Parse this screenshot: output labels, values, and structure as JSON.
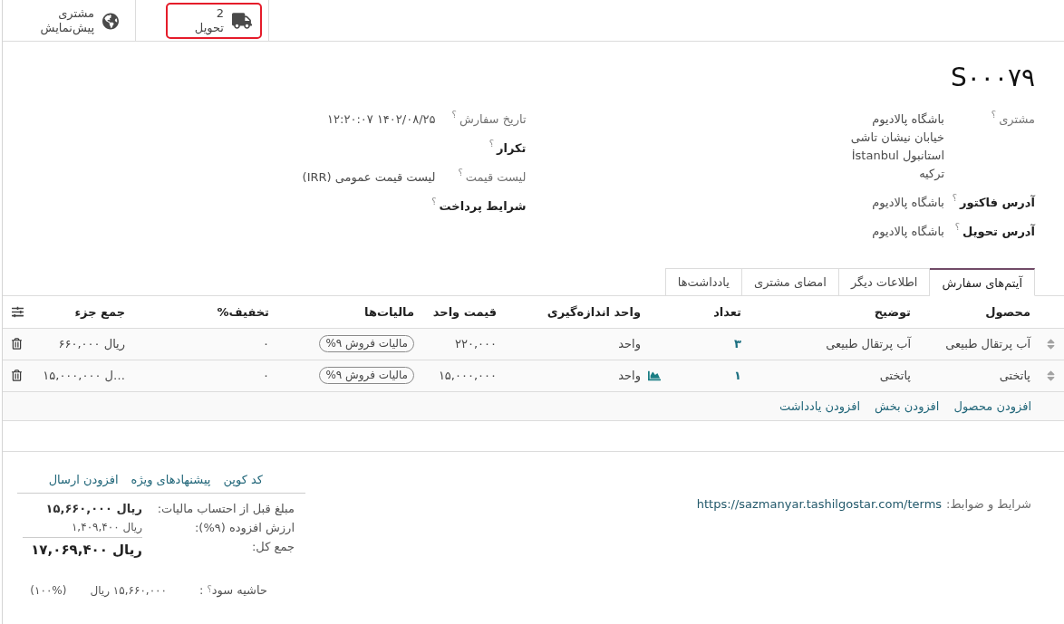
{
  "smart_buttons": [
    {
      "kind": "delivery",
      "value": "2",
      "label": "تحویل",
      "highlighted": true
    },
    {
      "kind": "preview",
      "value": "مشتری",
      "label": "پیش‌نمایش",
      "highlighted": false
    }
  ],
  "record": {
    "name": "S۰۰۰۷۹"
  },
  "field_groups": [
    {
      "fields": [
        {
          "label": "مشتری",
          "help": "؟",
          "emphasized": false,
          "lines": [
            "باشگاه پالادیوم",
            "خیابان نیشان تاشی",
            "استانبول İstanbul",
            "ترکیه"
          ]
        },
        {
          "label": "آدرس فاکتور",
          "help": "؟",
          "emphasized": true,
          "lines": [
            "باشگاه پالادیوم"
          ]
        },
        {
          "label": "آدرس تحویل",
          "help": "؟",
          "emphasized": true,
          "lines": [
            "باشگاه پالادیوم"
          ]
        }
      ]
    },
    {
      "fields": [
        {
          "label": "تاریخ سفارش",
          "help": "؟",
          "emphasized": false,
          "lines": [
            "۱۴۰۲/۰۸/۲۵ ۱۲:۲۰:۰۷"
          ]
        },
        {
          "label": "تکرار",
          "help": "؟",
          "emphasized": true
        },
        {
          "label": "لیست قیمت",
          "help": "؟",
          "emphasized": false,
          "lines": [
            "لیست قیمت عمومی (IRR)"
          ]
        },
        {
          "label": "شرایط پرداخت",
          "help": "؟",
          "emphasized": true
        }
      ]
    }
  ],
  "tabs": [
    {
      "label": "آیتم‌های سفارش",
      "selected": true
    },
    {
      "label": "اطلاعات دیگر",
      "selected": false
    },
    {
      "label": "امضای مشتری",
      "selected": false
    },
    {
      "label": "یادداشت‌ها",
      "selected": false
    }
  ],
  "order_lines": {
    "columns": [
      "محصول",
      "توضیح",
      "تعداد",
      "واحد اندازه‌گیری",
      "قیمت واحد",
      "مالیات‌ها",
      "تخفیف%",
      "جمع جزء"
    ],
    "rows": [
      {
        "product": "آب پرتقال طبیعی",
        "description": "آب پرتقال طبیعی",
        "quantity": "۳",
        "forecast": false,
        "uom": "واحد",
        "unit_price": "۲۲۰,۰۰۰",
        "tax": "مالیات فروش ۹%",
        "discount": "۰",
        "subtotal": "۶۶۰,۰۰۰ ریال"
      },
      {
        "product": "پاتختی",
        "description": "پاتختی",
        "quantity": "۱",
        "forecast": true,
        "uom": "واحد",
        "unit_price": "۱۵,۰۰۰,۰۰۰",
        "tax": "مالیات فروش ۹%",
        "discount": "۰",
        "subtotal": "۱۵,۰۰۰,۰۰۰ ل…"
      }
    ],
    "add_actions": [
      "افزودن محصول",
      "افزودن بخش",
      "افزودن یادداشت"
    ]
  },
  "terms": {
    "label": "شرایط و ضوابط:",
    "url": "https://sazmanyar.tashilgostar.com/terms"
  },
  "promo_buttons": [
    "کد کوپن",
    "پیشنهادهای ویژه",
    "افزودن ارسال"
  ],
  "totals": [
    {
      "kind": "untaxed",
      "label": "مبلغ قبل از احتساب مالیات:",
      "value": "ریال ۱۵,۶۶۰,۰۰۰"
    },
    {
      "kind": "tax",
      "label": "ارزش افزوده (۹%):",
      "value": "ریال ۱,۴۰۹,۴۰۰"
    },
    {
      "kind": "total",
      "label": "جمع کل:",
      "value": "ریال ۱۷,۰۶۹,۴۰۰"
    }
  ],
  "margin": {
    "label": "حاشیه سود",
    "help": "؟",
    "separator": ":",
    "amount": "۱۵,۶۶۰,۰۰۰ ریال",
    "percent": "(۱۰۰%)"
  }
}
